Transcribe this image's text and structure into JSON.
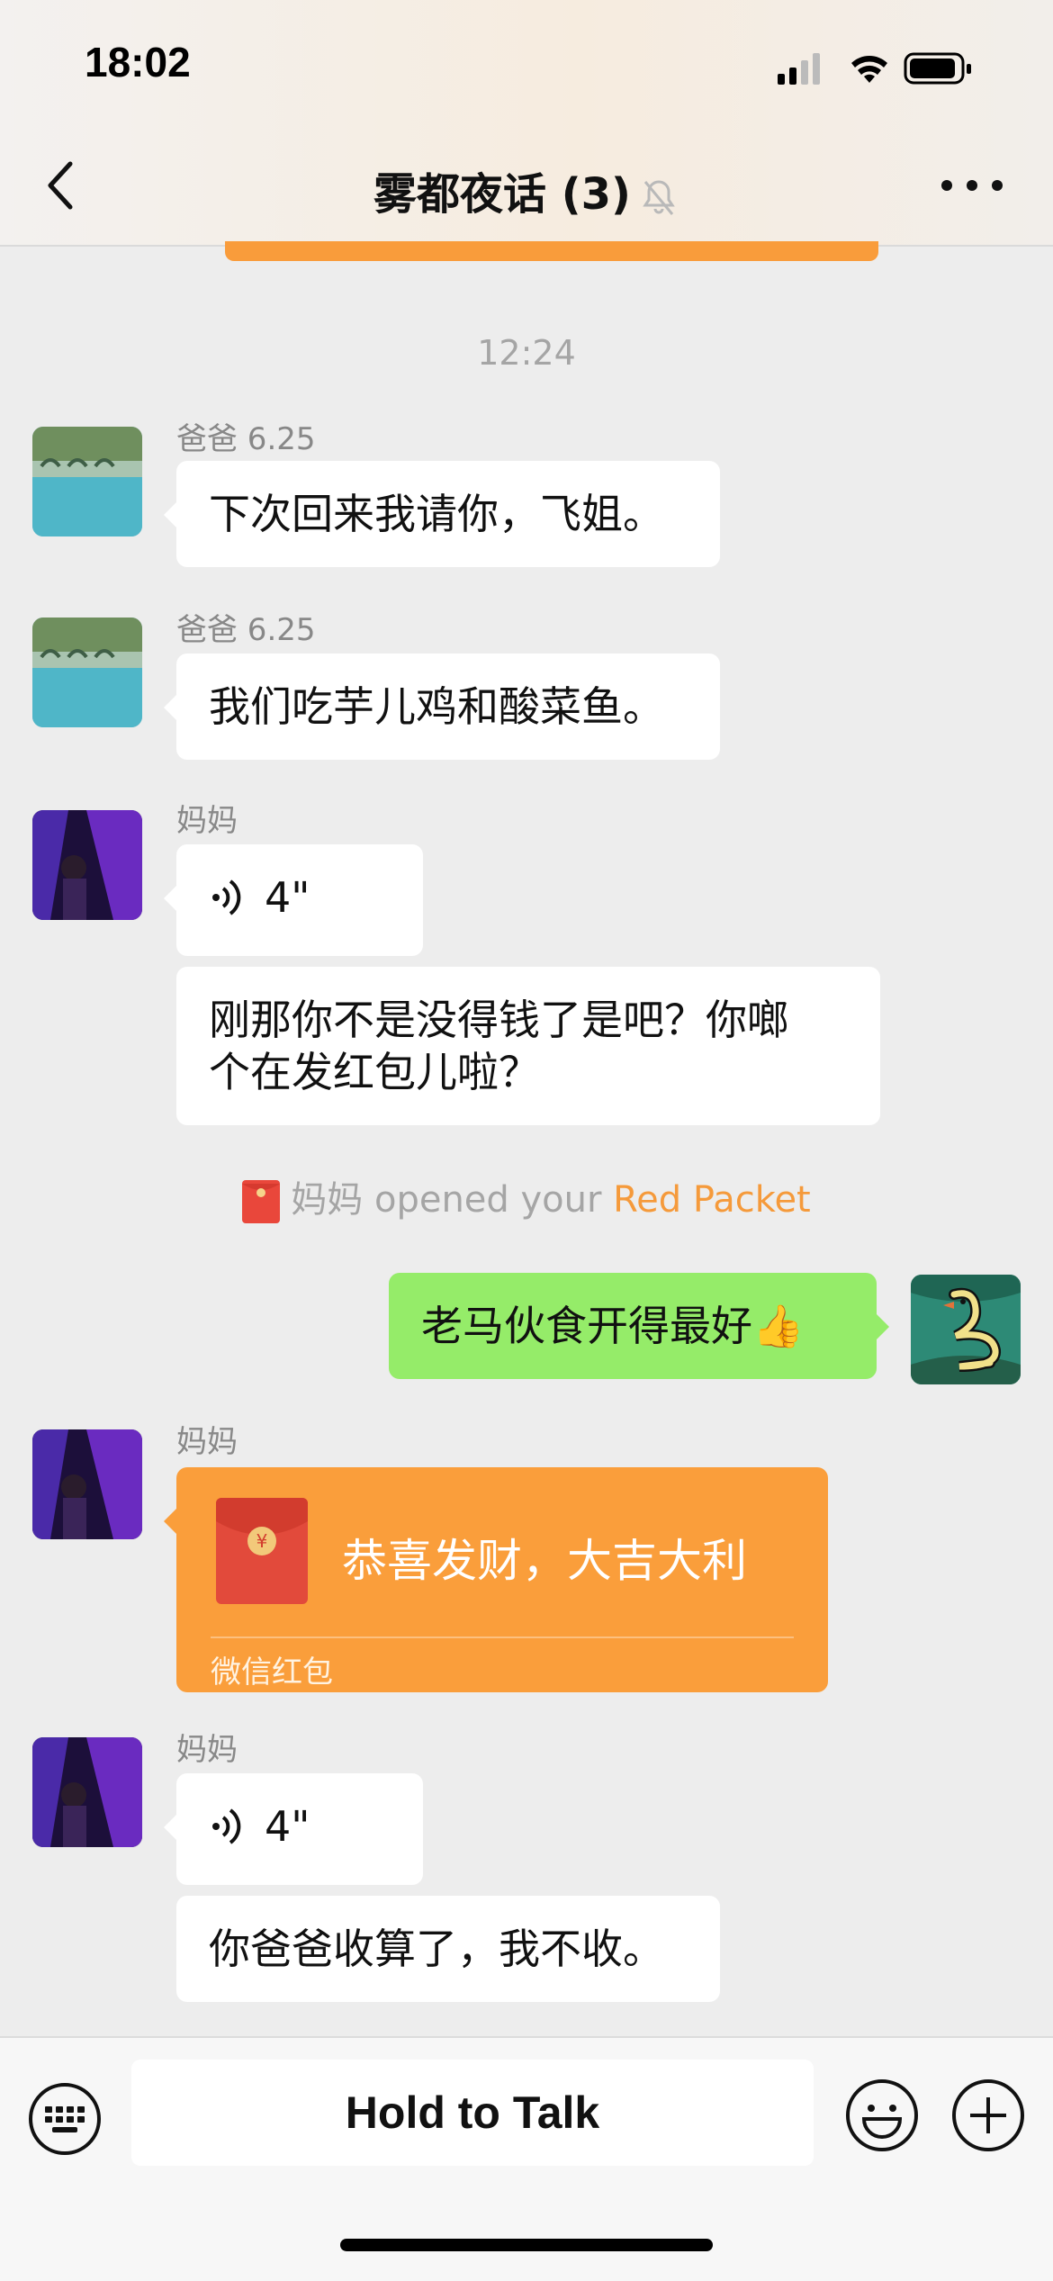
{
  "status_bar": {
    "time": "18:02"
  },
  "header": {
    "title": "雾都夜话 (3)"
  },
  "chat": {
    "timestamp": "12:24",
    "messages": [
      {
        "sender": "爸爸 6.25",
        "text": "下次回来我请你，飞姐。"
      },
      {
        "sender": "爸爸 6.25",
        "text": "我们吃芋儿鸡和酸菜鱼。"
      },
      {
        "sender": "妈妈",
        "voice_duration": "4\""
      },
      {
        "text_line1": "刚那你不是没得钱了是吧？你啷",
        "text_line2": "个在发红包儿啦？"
      },
      {
        "self_text": "老马伙食开得最好👍"
      },
      {
        "sender": "妈妈",
        "red_packet_title": "恭喜发财，大吉大利",
        "red_packet_label": "微信红包"
      },
      {
        "sender": "妈妈",
        "voice_duration": "4\""
      },
      {
        "text": "你爸爸收算了，我不收。"
      }
    ],
    "notice": {
      "sender": "妈妈",
      "text": "opened your",
      "link": "Red Packet"
    }
  },
  "input_bar": {
    "hold_to_talk": "Hold to Talk"
  },
  "colors": {
    "self_bubble": "#95ec69",
    "red_packet": "#fa9e3b",
    "link": "#f59a3b"
  }
}
